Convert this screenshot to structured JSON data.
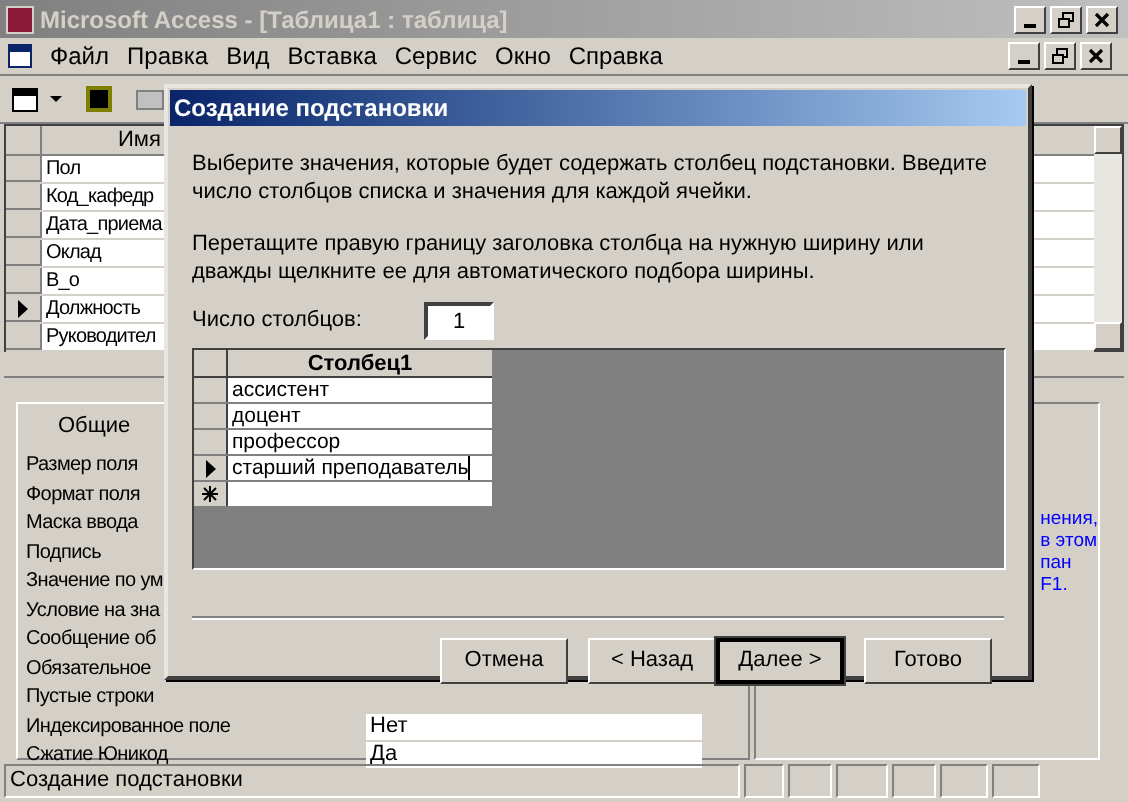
{
  "window": {
    "title": "Microsoft Access - [Таблица1 : таблица]",
    "active": false
  },
  "menu": [
    {
      "label": "Файл"
    },
    {
      "label": "Правка"
    },
    {
      "label": "Вид"
    },
    {
      "label": "Вставка"
    },
    {
      "label": "Сервис"
    },
    {
      "label": "Окно"
    },
    {
      "label": "Справка"
    }
  ],
  "design_grid": {
    "header": "Имя",
    "rows": [
      {
        "name": "Пол",
        "current": false
      },
      {
        "name": "Код_кафедр",
        "current": false
      },
      {
        "name": "Дата_приема",
        "current": false
      },
      {
        "name": "Оклад",
        "current": false
      },
      {
        "name": "В_о",
        "current": false
      },
      {
        "name": "Должность",
        "current": true
      },
      {
        "name": "Руководител",
        "current": false
      }
    ]
  },
  "properties": {
    "tab": "Общие",
    "rows": [
      {
        "label": "Размер поля"
      },
      {
        "label": "Формат поля"
      },
      {
        "label": "Маска ввода"
      },
      {
        "label": "Подпись"
      },
      {
        "label": "Значение по ум"
      },
      {
        "label": "Условие на зна"
      },
      {
        "label": "Сообщение об"
      },
      {
        "label": "Обязательное"
      },
      {
        "label": "Пустые строки"
      },
      {
        "label": "Индексированное поле",
        "value": "Нет"
      },
      {
        "label": "Сжатие Юникод",
        "value": "Да"
      }
    ],
    "help_lines": [
      "нения,",
      "в этом",
      "пан",
      "F1."
    ]
  },
  "dialog": {
    "title": "Создание подстановки",
    "intro": "Выберите значения, которые будет содержать столбец подстановки. Введите число столбцов списка и значения для каждой ячейки.",
    "hint": "Перетащите правую границу заголовка столбца на нужную ширину или дважды щелкните ее для автоматического подбора ширины.",
    "columns_label": "Число столбцов:",
    "columns_value": "1",
    "grid": {
      "column": "Столбец1",
      "rows": [
        {
          "value": "ассистент",
          "current": false
        },
        {
          "value": "доцент",
          "current": false
        },
        {
          "value": "профессор",
          "current": false
        },
        {
          "value": "старший преподаватель",
          "current": true
        }
      ]
    },
    "buttons": [
      {
        "label": "Отмена",
        "default": false
      },
      {
        "label": "< Назад",
        "default": false
      },
      {
        "label": "Далее >",
        "default": true
      },
      {
        "label": "Готово",
        "default": false
      }
    ]
  },
  "status_bar": {
    "text": "Создание подстановки"
  }
}
